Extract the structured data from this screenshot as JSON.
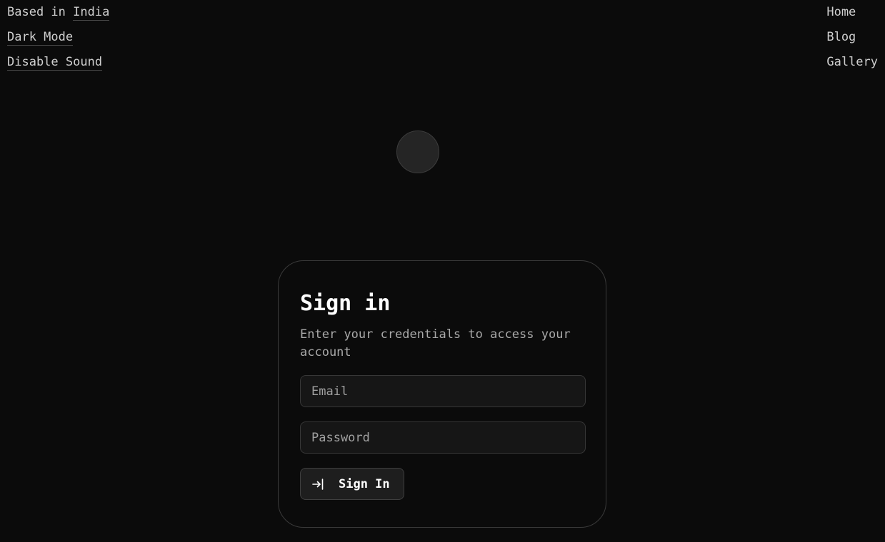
{
  "top_left": {
    "based_prefix": "Based in",
    "location": "India",
    "dark_mode": "Dark Mode",
    "sound": "Disable Sound"
  },
  "nav": {
    "home": "Home",
    "blog": "Blog",
    "gallery": "Gallery"
  },
  "card": {
    "title": "Sign in",
    "subtitle": "Enter your credentials to access your account",
    "email_placeholder": "Email",
    "password_placeholder": "Password",
    "submit_label": "Sign In",
    "submit_icon": "sign-in-icon"
  },
  "colors": {
    "background": "#0b0b0b",
    "card_border": "#3a3a3a",
    "input_bg": "#161616",
    "text_primary": "#ffffff",
    "text_muted": "#a9a9a9"
  }
}
